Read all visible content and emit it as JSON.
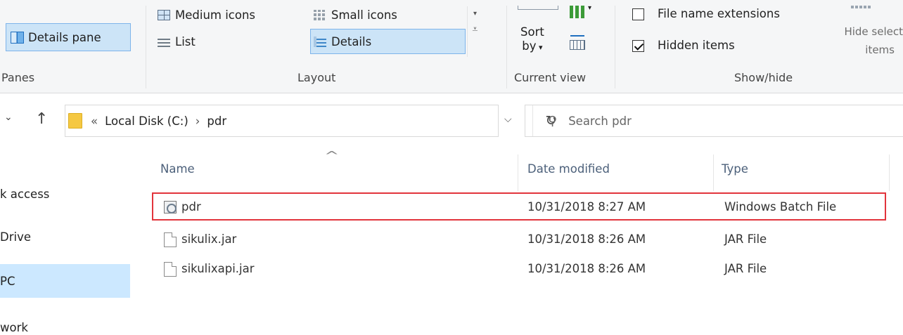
{
  "ribbon": {
    "panes": {
      "details_pane_label": "Details pane",
      "group_label": "Panes"
    },
    "layout": {
      "medium_icons": "Medium icons",
      "small_icons": "Small icons",
      "list": "List",
      "details": "Details",
      "group_label": "Layout"
    },
    "current_view": {
      "sort_label": "Sort",
      "sort_by": "by",
      "group_label": "Current view"
    },
    "show_hide": {
      "file_name_extensions": "File name extensions",
      "file_name_extensions_checked": false,
      "hidden_items": "Hidden items",
      "hidden_items_checked": true,
      "hide_selected_line1": "Hide select",
      "hide_selected_line2": "items",
      "group_label": "Show/hide"
    }
  },
  "address_bar": {
    "overflow": "«",
    "crumbs": [
      "Local Disk (C:)",
      "pdr"
    ],
    "separator": "›"
  },
  "search": {
    "placeholder": "Search pdr"
  },
  "nav_pane": {
    "items": [
      {
        "label": "k access",
        "selected": false
      },
      {
        "label": "Drive",
        "selected": false
      },
      {
        "label": "PC",
        "selected": true
      },
      {
        "label": "work",
        "selected": false
      }
    ]
  },
  "file_list": {
    "columns": {
      "name": "Name",
      "date_modified": "Date modified",
      "type": "Type"
    },
    "rows": [
      {
        "name": "pdr",
        "date": "10/31/2018 8:27 AM",
        "type": "Windows Batch File",
        "icon": "batch-file-icon",
        "highlighted": true
      },
      {
        "name": "sikulix.jar",
        "date": "10/31/2018 8:26 AM",
        "type": "JAR File",
        "icon": "file-icon",
        "highlighted": false
      },
      {
        "name": "sikulixapi.jar",
        "date": "10/31/2018 8:26 AM",
        "type": "JAR File",
        "icon": "file-icon",
        "highlighted": false
      }
    ]
  },
  "colors": {
    "selection_bg": "#cce4f7",
    "highlight_border": "#e2343c",
    "header_text": "#4c607a"
  }
}
